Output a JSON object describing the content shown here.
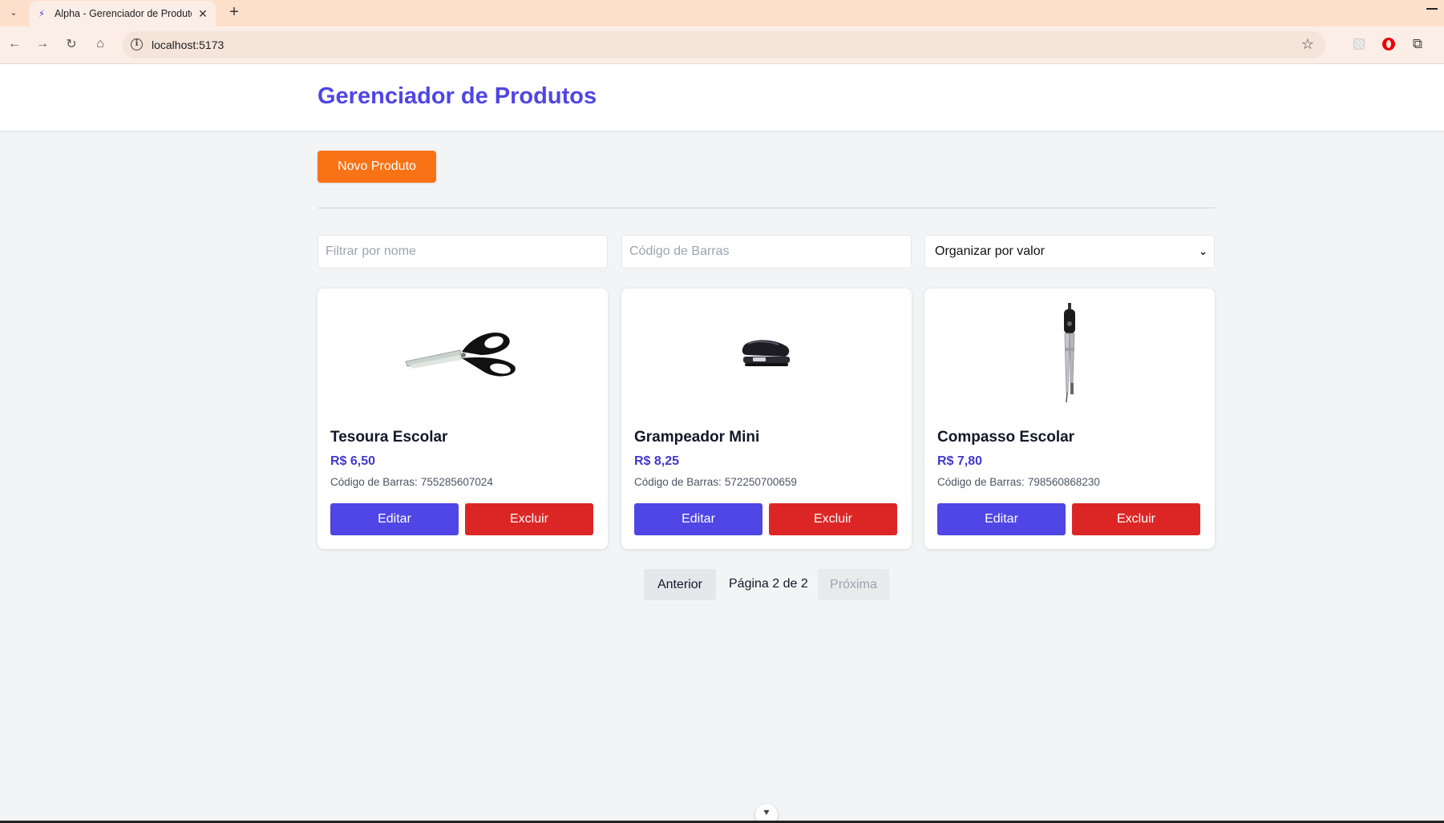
{
  "browser": {
    "tab_title": "Alpha - Gerenciador de Produtos",
    "tab_close": "✕",
    "new_tab": "+",
    "url": "localhost:5173"
  },
  "app": {
    "title": "Gerenciador de Produtos",
    "new_product_label": "Novo Produto"
  },
  "filters": {
    "name_placeholder": "Filtrar por nome",
    "barcode_placeholder": "Código de Barras",
    "sort_selected": "Organizar por valor"
  },
  "products": [
    {
      "name": "Tesoura Escolar",
      "price": "R$ 6,50",
      "barcode_label": "Código de Barras:",
      "barcode": "755285607024",
      "image_icon": "scissors-icon",
      "edit_label": "Editar",
      "delete_label": "Excluir"
    },
    {
      "name": "Grampeador Mini",
      "price": "R$ 8,25",
      "barcode_label": "Código de Barras:",
      "barcode": "572250700659",
      "image_icon": "stapler-icon",
      "edit_label": "Editar",
      "delete_label": "Excluir"
    },
    {
      "name": "Compasso Escolar",
      "price": "R$ 7,80",
      "barcode_label": "Código de Barras:",
      "barcode": "798560868230",
      "image_icon": "compass-icon",
      "edit_label": "Editar",
      "delete_label": "Excluir"
    }
  ],
  "pagination": {
    "prev_label": "Anterior",
    "info": "Página 2 de 2",
    "next_label": "Próxima"
  },
  "colors": {
    "brand": "#4f46e5",
    "accent_orange": "#f97316",
    "danger": "#dc2626"
  }
}
